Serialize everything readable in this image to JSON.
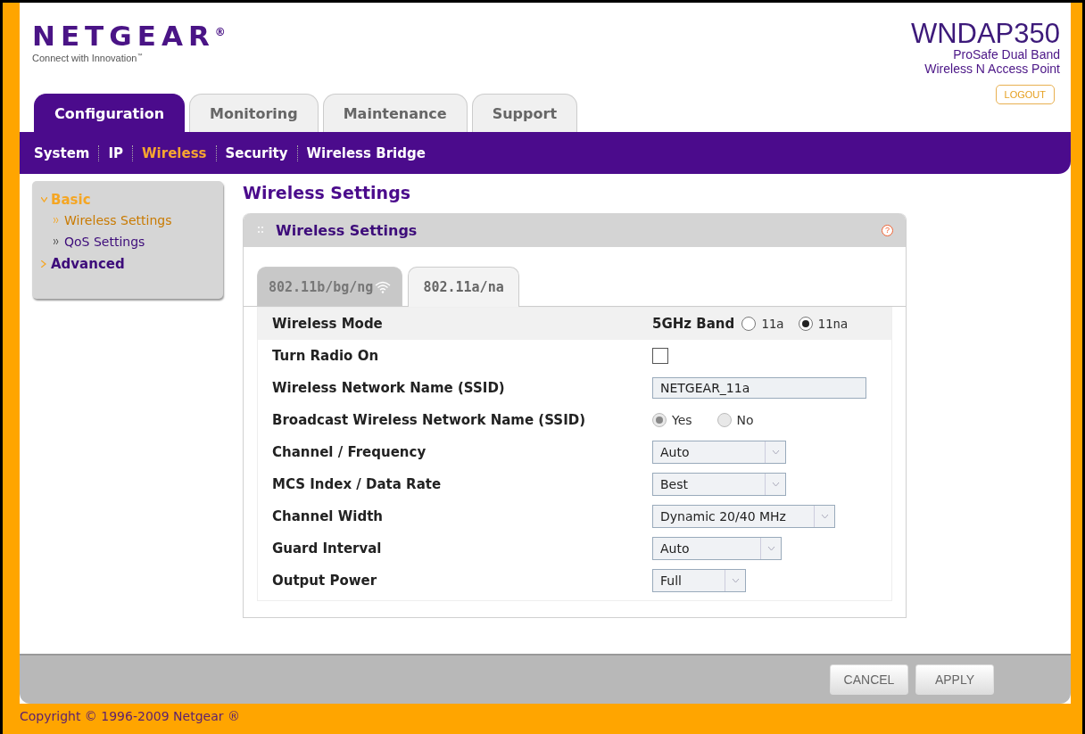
{
  "brand": {
    "logo": "NETGEAR",
    "mark": "®",
    "tagline": "Connect with Innovation",
    "tagline_mark": "™"
  },
  "product": {
    "model": "WNDAP350",
    "line1": "ProSafe Dual Band",
    "line2": "Wireless N Access Point"
  },
  "logout": "LOGOUT",
  "tabs": [
    {
      "label": "Configuration",
      "selected": true
    },
    {
      "label": "Monitoring",
      "selected": false
    },
    {
      "label": "Maintenance",
      "selected": false
    },
    {
      "label": "Support",
      "selected": false
    }
  ],
  "subnav": [
    {
      "label": "System",
      "selected": false
    },
    {
      "label": "IP",
      "selected": false
    },
    {
      "label": "Wireless",
      "selected": true
    },
    {
      "label": "Security",
      "selected": false
    },
    {
      "label": "Wireless Bridge",
      "selected": false
    }
  ],
  "sidebar": {
    "items": [
      {
        "label": "Basic",
        "expanded": true,
        "selected": true,
        "children": [
          {
            "label": "Wireless Settings",
            "selected": true
          },
          {
            "label": "QoS Settings",
            "selected": false
          }
        ]
      },
      {
        "label": "Advanced",
        "expanded": false,
        "selected": false
      }
    ]
  },
  "page_title": "Wireless Settings",
  "panel": {
    "title": "Wireless Settings",
    "help": "?",
    "band_tabs": [
      {
        "label": "802.11b/bg/ng",
        "selected": false,
        "wifi_icon": true
      },
      {
        "label": "802.11a/na",
        "selected": true,
        "wifi_icon": false
      }
    ],
    "rows": [
      {
        "kind": "radio",
        "label": "Wireless Mode",
        "prefix": "5GHz Band",
        "disabled": false,
        "options": [
          {
            "label": "11a",
            "selected": false
          },
          {
            "label": "11na",
            "selected": true
          }
        ]
      },
      {
        "kind": "checkbox",
        "label": "Turn Radio On",
        "checked": false
      },
      {
        "kind": "text",
        "label": "Wireless Network Name (SSID)",
        "value": "NETGEAR_11a"
      },
      {
        "kind": "radio",
        "label": "Broadcast Wireless Network Name (SSID)",
        "disabled": true,
        "options": [
          {
            "label": "Yes",
            "selected": true
          },
          {
            "label": "No",
            "selected": false
          }
        ]
      },
      {
        "kind": "select",
        "label": "Channel / Frequency",
        "value": "Auto"
      },
      {
        "kind": "select",
        "label": "MCS Index / Data Rate",
        "value": "Best"
      },
      {
        "kind": "select",
        "label": "Channel Width",
        "value": "Dynamic 20/40 MHz"
      },
      {
        "kind": "select",
        "label": "Guard Interval",
        "value": "Auto"
      },
      {
        "kind": "select",
        "label": "Output Power",
        "value": "Full"
      }
    ]
  },
  "buttons": [
    "CANCEL",
    "APPLY"
  ],
  "copyright": "Copyright © 1996-2009 Netgear ®"
}
